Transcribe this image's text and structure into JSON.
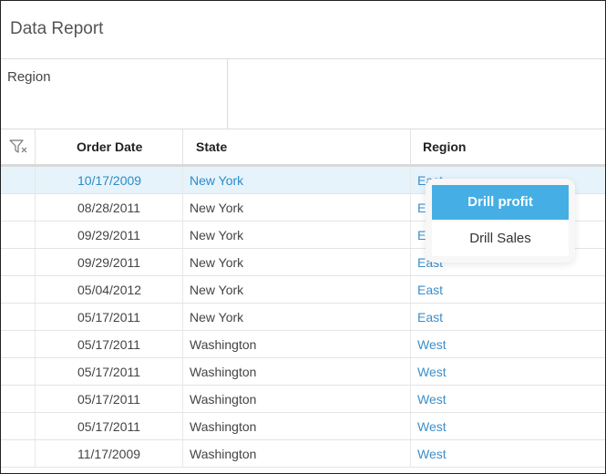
{
  "report": {
    "title": "Data Report"
  },
  "group_panel": {
    "label": "Region"
  },
  "table": {
    "columns": [
      "Order Date",
      "State",
      "Region"
    ],
    "rows": [
      {
        "date": "10/17/2009",
        "state": "New York",
        "region": "East",
        "selected": true
      },
      {
        "date": "08/28/2011",
        "state": "New York",
        "region": "East"
      },
      {
        "date": "09/29/2011",
        "state": "New York",
        "region": "East"
      },
      {
        "date": "09/29/2011",
        "state": "New York",
        "region": "East"
      },
      {
        "date": "05/04/2012",
        "state": "New York",
        "region": "East"
      },
      {
        "date": "05/17/2011",
        "state": "New York",
        "region": "East"
      },
      {
        "date": "05/17/2011",
        "state": "Washington",
        "region": "West"
      },
      {
        "date": "05/17/2011",
        "state": "Washington",
        "region": "West"
      },
      {
        "date": "05/17/2011",
        "state": "Washington",
        "region": "West"
      },
      {
        "date": "05/17/2011",
        "state": "Washington",
        "region": "West"
      },
      {
        "date": "11/17/2009",
        "state": "Washington",
        "region": "West"
      }
    ]
  },
  "context_menu": {
    "items": [
      {
        "label": "Drill profit",
        "active": true
      },
      {
        "label": "Drill Sales",
        "active": false
      }
    ]
  },
  "icons": {
    "filter": "filter-icon"
  },
  "colors": {
    "accent": "#45aee4",
    "link": "#3d8ec9",
    "selected_row": "#e6f3fb"
  }
}
